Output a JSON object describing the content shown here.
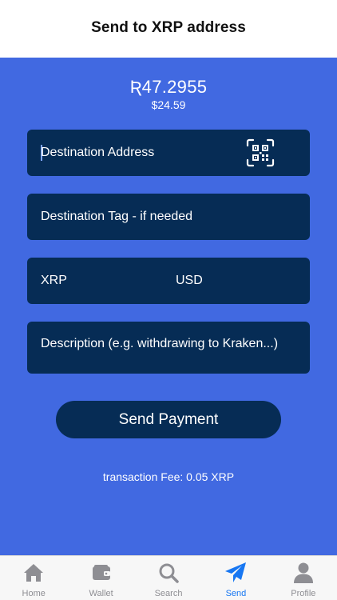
{
  "header": {
    "title": "Send to XRP address"
  },
  "balance": {
    "xrp": "Ʀ47.2955",
    "usd": "$24.59"
  },
  "form": {
    "destination_placeholder": "Destination Address",
    "tag_placeholder": "Destination Tag - if needed",
    "xrp_label": "XRP",
    "usd_label": "USD",
    "description_placeholder": "Description (e.g. withdrawing to Kraken...)"
  },
  "send_button": {
    "label": "Send Payment"
  },
  "fee": {
    "text": "transaction Fee: 0.05 XRP"
  },
  "tabbar": {
    "tabs": [
      {
        "label": "Home",
        "icon": "home-icon"
      },
      {
        "label": "Wallet",
        "icon": "wallet-icon"
      },
      {
        "label": "Search",
        "icon": "search-icon"
      },
      {
        "label": "Send",
        "icon": "paper-plane-icon",
        "active": true
      },
      {
        "label": "Profile",
        "icon": "profile-icon"
      }
    ]
  },
  "colors": {
    "background": "#4169e1",
    "field": "#062c55",
    "active_tab": "#1877f2",
    "inactive_tab": "#8e8e93"
  }
}
